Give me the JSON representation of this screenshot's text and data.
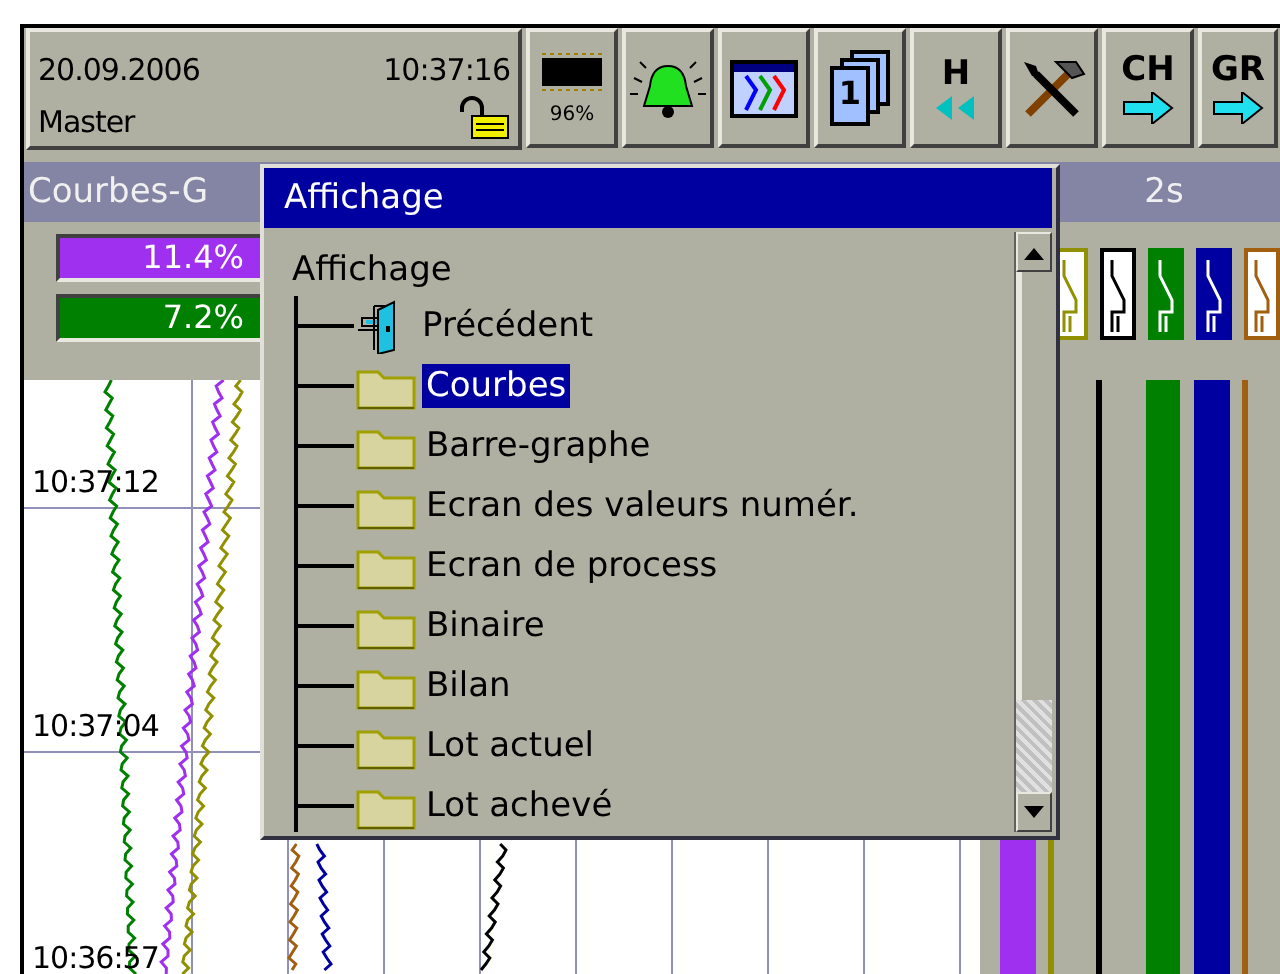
{
  "status": {
    "date": "20.09.2006",
    "time": "10:37:16",
    "user": "Master",
    "locked": false
  },
  "toolbar": [
    {
      "kind": "memory",
      "label": "96%"
    },
    {
      "kind": "alarm"
    },
    {
      "kind": "curves"
    },
    {
      "kind": "page",
      "label": "1"
    },
    {
      "kind": "history",
      "label": "H"
    },
    {
      "kind": "tools"
    },
    {
      "kind": "channel",
      "label": "CH"
    },
    {
      "kind": "group",
      "label": "GR"
    }
  ],
  "group_panel": {
    "title": "Courbes-G",
    "values": [
      {
        "text": "11.4%",
        "color": "#a030f0"
      },
      {
        "text": "7.2%",
        "color": "#008000"
      }
    ]
  },
  "binary_panel": {
    "title": "2s",
    "signals": [
      {
        "color": "#909000",
        "on": false
      },
      {
        "color": "#000000",
        "on": false
      },
      {
        "color": "#008000",
        "on": true
      },
      {
        "color": "#0000a0",
        "on": true
      },
      {
        "color": "#a06010",
        "on": false
      }
    ]
  },
  "chart": {
    "time_labels": [
      "10:37:12",
      "10:37:04",
      "10:36:57"
    ]
  },
  "dialog": {
    "title": "Affichage",
    "tree": {
      "label": "Affichage",
      "children": [
        {
          "label": "Précédent",
          "kind": "back",
          "selected": false
        },
        {
          "label": "Courbes",
          "kind": "folder",
          "selected": true
        },
        {
          "label": "Barre-graphe",
          "kind": "folder",
          "selected": false
        },
        {
          "label": "Ecran des valeurs numér.",
          "kind": "folder",
          "selected": false
        },
        {
          "label": "Ecran de process",
          "kind": "folder",
          "selected": false
        },
        {
          "label": "Binaire",
          "kind": "folder",
          "selected": false
        },
        {
          "label": "Bilan",
          "kind": "folder",
          "selected": false
        },
        {
          "label": "Lot actuel",
          "kind": "folder",
          "selected": false
        },
        {
          "label": "Lot achevé",
          "kind": "folder",
          "selected": false
        }
      ]
    }
  }
}
